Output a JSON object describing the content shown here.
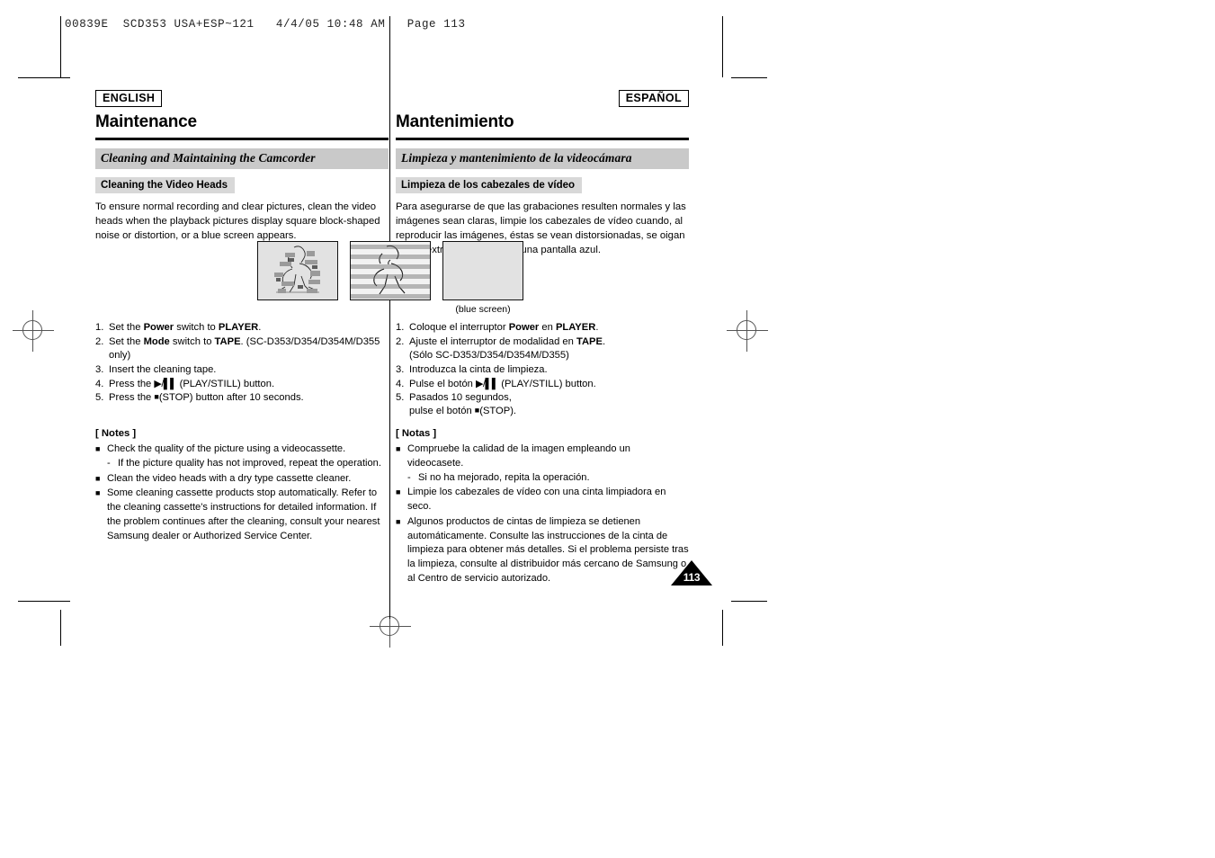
{
  "print_header": "00839E  SCD353 USA+ESP~121   4/4/05 10:48 AM   Page 113",
  "english": {
    "lang_badge": "ENGLISH",
    "chapter_title": "Maintenance",
    "section_band": "Cleaning and Maintaining the Camcorder",
    "subsection_band": "Cleaning the Video Heads",
    "intro": "To ensure normal recording and clear pictures, clean the video heads when the playback pictures display square block-shaped noise or distortion, or a blue screen appears.",
    "steps": [
      {
        "num": "1.",
        "pre": "Set the ",
        "b1": "Power",
        "mid": " switch to ",
        "b2": "PLAYER",
        "post": "."
      },
      {
        "num": "2.",
        "pre": "Set the ",
        "b1": "Mode",
        "mid": " switch to ",
        "b2": "TAPE",
        "post": ". (SC-D353/D354/D354M/D355 only)"
      },
      {
        "num": "3.",
        "pre": "Insert the cleaning tape.",
        "b1": "",
        "mid": "",
        "b2": "",
        "post": ""
      },
      {
        "num": "4.",
        "pre": "Press the ",
        "glyph": "play",
        "post": " (PLAY/STILL) button."
      },
      {
        "num": "5.",
        "pre": "Press the ",
        "glyph": "stop",
        "post": "(STOP) button after 10 seconds."
      }
    ],
    "notes_title": "[ Notes ]",
    "notes": [
      {
        "text": "Check the quality of the picture using a videocassette.",
        "sub": "If the picture quality has not improved, repeat the operation."
      },
      {
        "text": "Clean the video heads with a dry type cassette cleaner.",
        "sub": ""
      },
      {
        "text": "Some cleaning cassette products stop automatically. Refer to the cleaning cassette's instructions for detailed information. If the problem continues after the cleaning, consult your nearest Samsung dealer or Authorized Service Center.",
        "sub": ""
      }
    ]
  },
  "spanish": {
    "lang_badge": "ESPAÑOL",
    "chapter_title": "Mantenimiento",
    "section_band": "Limpieza y mantenimiento de la videocámara",
    "subsection_band": "Limpieza de los cabezales de vídeo",
    "intro": "Para asegurarse de que las grabaciones resulten normales y las imágenes sean claras, limpie los cabezales de vídeo cuando, al reproducir las imágenes, éstas se vean distorsionadas, se oigan ruidos extraños o aparezca una pantalla azul.",
    "steps": [
      {
        "num": "1.",
        "pre": "Coloque el interruptor ",
        "b1": "Power",
        "mid": " en ",
        "b2": "PLAYER",
        "post": "."
      },
      {
        "num": "2.",
        "pre": "Ajuste el interruptor de modalidad en ",
        "b1": "",
        "mid": "",
        "b2": "TAPE",
        "post": ".",
        "cont": "(Sólo SC-D353/D354/D354M/D355)"
      },
      {
        "num": "3.",
        "pre": "Introduzca la cinta de limpieza.",
        "b1": "",
        "mid": "",
        "b2": "",
        "post": ""
      },
      {
        "num": "4.",
        "pre": "Pulse el botón ",
        "glyph": "play",
        "post": " (PLAY/STILL) button."
      },
      {
        "num": "5.",
        "pre": "Pasados 10 segundos,",
        "glyph": "",
        "post": "",
        "cont2_pre": "pulse el botón ",
        "cont2_glyph": "stop",
        "cont2_post": "(STOP)."
      }
    ],
    "notes_title": "[ Notas ]",
    "notes": [
      {
        "text": "Compruebe la calidad de la imagen empleando un videocasete.",
        "sub": "Si no ha mejorado, repita la operación."
      },
      {
        "text": "Limpie los cabezales de vídeo con una cinta limpiadora en seco.",
        "sub": ""
      },
      {
        "text": "Algunos productos de cintas de limpieza se detienen automáticamente. Consulte las instrucciones de la cinta de limpieza para obtener más detalles. Si el problema persiste tras la limpieza, consulte al distribuidor más cercano de Samsung o al Centro de servicio autorizado.",
        "sub": ""
      }
    ]
  },
  "figures": {
    "fig1_alt": "block-noise-picture",
    "fig2_alt": "striped-distortion-picture",
    "fig3_alt": "blank-blue-screen",
    "fig3_caption": "(blue screen)"
  },
  "page_number": "113"
}
